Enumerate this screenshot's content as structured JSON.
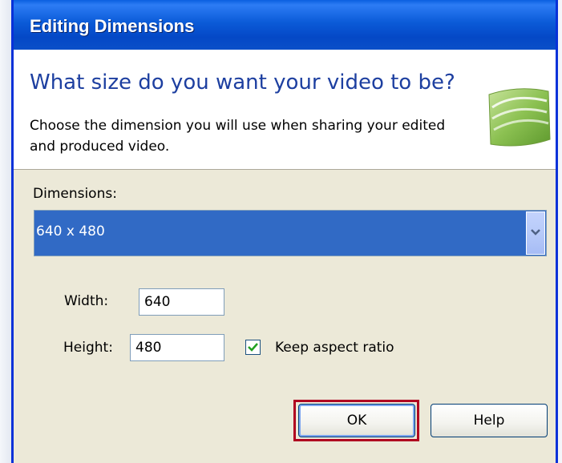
{
  "dialog": {
    "title": "Editing Dimensions",
    "heading": "What size do you want your video to be?",
    "description": "Choose the dimension you will use when sharing your edited and produced video."
  },
  "dimensions": {
    "label": "Dimensions:",
    "selected": "640 x 480"
  },
  "width": {
    "label": "Width:",
    "value": "640"
  },
  "height": {
    "label": "Height:",
    "value": "480"
  },
  "aspect": {
    "label": "Keep aspect ratio",
    "checked": true
  },
  "buttons": {
    "ok": "OK",
    "help": "Help"
  },
  "colors": {
    "title_bar": "#0b5bd8",
    "selection": "#316ac5",
    "heading_text": "#1d3fa0",
    "highlight_box": "#b00020",
    "logo_green": "#7bb543"
  },
  "icons": {
    "logo": "camtasia-logo-icon",
    "dropdown": "chevron-down-icon",
    "checkbox": "checkmark-icon"
  }
}
